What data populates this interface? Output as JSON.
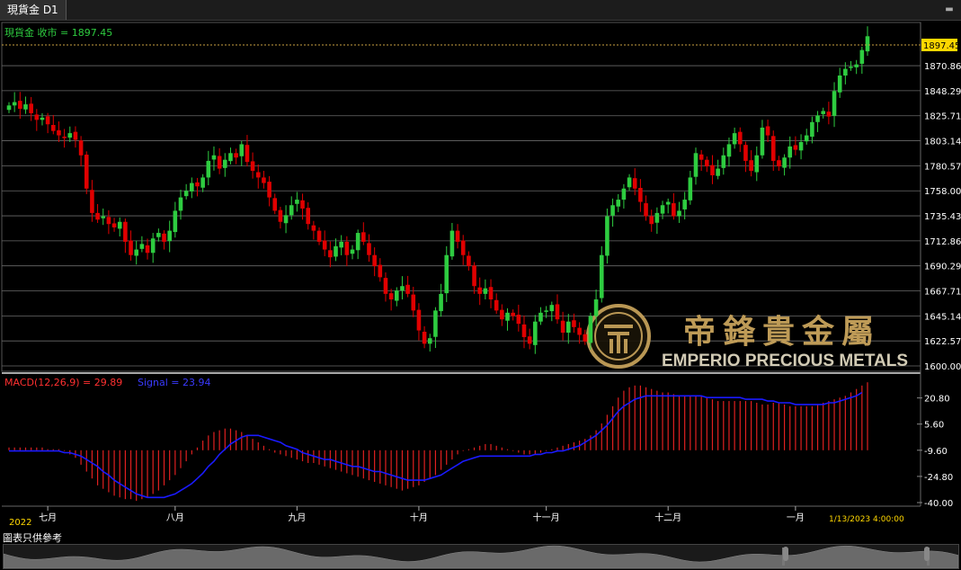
{
  "window": {
    "tab_title": "現貨金 D1"
  },
  "price_panel": {
    "legend": "現貨金 收市 = 1897.45",
    "last_price": "1897.45",
    "y_ticks": [
      "1870.86",
      "1848.29",
      "1825.71",
      "1803.14",
      "1780.57",
      "1758.00",
      "1735.43",
      "1712.86",
      "1690.29",
      "1667.71",
      "1645.14",
      "1622.57",
      "1600.00"
    ]
  },
  "macd_panel": {
    "label_macd": "MACD(12,26,9) = 29.89",
    "label_signal": "Signal = 23.94",
    "y_ticks": [
      "20.80",
      "5.60",
      "-9.60",
      "-24.80",
      "-40.00"
    ]
  },
  "x_axis": {
    "year": "2022",
    "months": [
      "七月",
      "八月",
      "九月",
      "十月",
      "十一月",
      "十二月",
      "一月"
    ],
    "last_date": "1/13/2023 4:00:00"
  },
  "watermark": {
    "logo_text": "帝鋒貴金屬",
    "company": "EMPERIO PRECIOUS METALS"
  },
  "footer": {
    "disclaimer": "圖表只供參考"
  },
  "colors": {
    "up": "#2ecc40",
    "down": "#e00000",
    "macd_hist": "#e02020",
    "signal": "#1a1aff",
    "axis_text": "#ffffff",
    "gold": "#c9a45c"
  },
  "chart_data": [
    {
      "type": "candlestick",
      "title": "現貨金 D1",
      "ylim": [
        1600.0,
        1905
      ],
      "date_range": [
        "2022-06-22",
        "2023-01-13"
      ],
      "close_series": [
        1835,
        1838,
        1832,
        1836,
        1828,
        1822,
        1824,
        1818,
        1812,
        1808,
        1806,
        1810,
        1804,
        1790,
        1760,
        1738,
        1732,
        1735,
        1728,
        1725,
        1730,
        1712,
        1700,
        1705,
        1710,
        1702,
        1715,
        1720,
        1712,
        1722,
        1740,
        1752,
        1758,
        1765,
        1762,
        1770,
        1785,
        1790,
        1778,
        1786,
        1792,
        1788,
        1800,
        1784,
        1776,
        1770,
        1765,
        1752,
        1740,
        1730,
        1736,
        1745,
        1750,
        1742,
        1728,
        1722,
        1712,
        1705,
        1698,
        1708,
        1712,
        1700,
        1705,
        1720,
        1712,
        1700,
        1690,
        1680,
        1665,
        1660,
        1668,
        1672,
        1665,
        1650,
        1632,
        1620,
        1625,
        1650,
        1665,
        1700,
        1722,
        1712,
        1700,
        1690,
        1672,
        1665,
        1670,
        1660,
        1650,
        1642,
        1648,
        1645,
        1638,
        1626,
        1620,
        1640,
        1648,
        1650,
        1655,
        1642,
        1630,
        1640,
        1635,
        1628,
        1622,
        1645,
        1660,
        1700,
        1735,
        1745,
        1750,
        1760,
        1770,
        1760,
        1748,
        1735,
        1728,
        1738,
        1745,
        1748,
        1735,
        1740,
        1750,
        1770,
        1792,
        1786,
        1780,
        1772,
        1778,
        1790,
        1800,
        1810,
        1800,
        1785,
        1776,
        1790,
        1815,
        1808,
        1785,
        1780,
        1788,
        1798,
        1795,
        1802,
        1808,
        1820,
        1826,
        1830,
        1825,
        1848,
        1862,
        1868,
        1870,
        1872,
        1885,
        1897.45
      ]
    },
    {
      "type": "bar",
      "title": "MACD(12,26,9)",
      "ylim": [
        -40.0,
        30
      ],
      "macd_last": 29.89,
      "signal_last": 23.94,
      "histogram": [
        -8,
        -8,
        -8,
        -8,
        -8,
        -8,
        -8,
        -9,
        -9,
        -9,
        -10,
        -12,
        -14,
        -18,
        -22,
        -26,
        -30,
        -32,
        -34,
        -36,
        -37,
        -38,
        -38,
        -39,
        -38,
        -37,
        -35,
        -33,
        -30,
        -27,
        -24,
        -20,
        -16,
        -12,
        -8,
        -4,
        -1,
        1,
        2,
        3,
        3,
        2,
        1,
        -1,
        -3,
        -5,
        -7,
        -9,
        -11,
        -12,
        -13,
        -14,
        -15,
        -16,
        -17,
        -17,
        -18,
        -19,
        -20,
        -21,
        -22,
        -23,
        -24,
        -25,
        -26,
        -27,
        -28,
        -29,
        -30,
        -31,
        -32,
        -33,
        -32,
        -31,
        -30,
        -28,
        -26,
        -24,
        -21,
        -18,
        -15,
        -12,
        -10,
        -9,
        -8,
        -7,
        -6,
        -6,
        -7,
        -8,
        -9,
        -10,
        -11,
        -12,
        -12,
        -12,
        -11,
        -10,
        -9,
        -8,
        -7,
        -6,
        -5,
        -4,
        -3,
        -1,
        2,
        6,
        11,
        16,
        21,
        25,
        27,
        28,
        28,
        27,
        26,
        25,
        24,
        24,
        23,
        22,
        22,
        22,
        22,
        22,
        21,
        20,
        19,
        19,
        19,
        19,
        19,
        19,
        19,
        18,
        17,
        17,
        18,
        18,
        17,
        16,
        16,
        16,
        16,
        16,
        17,
        18,
        19,
        20,
        21,
        22,
        24,
        26,
        28,
        29.89
      ],
      "signal": [
        -10,
        -10,
        -10,
        -10,
        -10,
        -10,
        -10,
        -10,
        -10,
        -10,
        -11,
        -11,
        -12,
        -13,
        -15,
        -17,
        -19,
        -22,
        -24,
        -27,
        -29,
        -31,
        -33,
        -35,
        -36,
        -37,
        -37,
        -37,
        -37,
        -36,
        -35,
        -33,
        -31,
        -29,
        -26,
        -23,
        -19,
        -16,
        -12,
        -9,
        -6,
        -4,
        -2,
        -1,
        -1,
        -1,
        -2,
        -3,
        -4,
        -5,
        -7,
        -8,
        -9,
        -11,
        -12,
        -13,
        -14,
        -15,
        -15,
        -16,
        -17,
        -18,
        -19,
        -19,
        -20,
        -21,
        -22,
        -22,
        -23,
        -24,
        -25,
        -26,
        -27,
        -27,
        -27,
        -27,
        -26,
        -25,
        -24,
        -22,
        -20,
        -18,
        -16,
        -15,
        -14,
        -13,
        -13,
        -13,
        -13,
        -13,
        -13,
        -13,
        -13,
        -13,
        -13,
        -12,
        -12,
        -11,
        -11,
        -10,
        -10,
        -9,
        -8,
        -7,
        -5,
        -3,
        -1,
        2,
        5,
        9,
        13,
        16,
        18,
        20,
        21,
        22,
        22,
        22,
        22,
        22,
        22,
        22,
        22,
        22,
        22,
        22,
        21,
        21,
        21,
        21,
        21,
        21,
        21,
        20,
        20,
        20,
        20,
        19,
        19,
        18,
        18,
        18,
        17,
        17,
        17,
        17,
        17,
        17,
        18,
        18,
        19,
        20,
        21,
        22,
        23.94
      ]
    }
  ]
}
